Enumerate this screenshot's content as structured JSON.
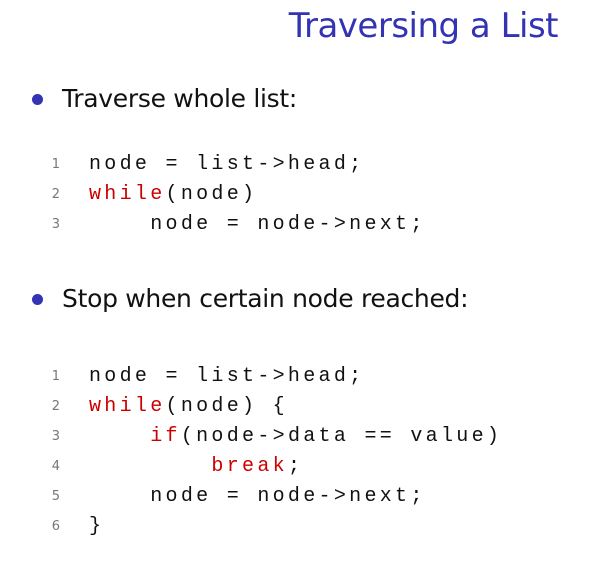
{
  "slide": {
    "title": "Traversing a List",
    "bullets": [
      {
        "text": "Traverse whole list:",
        "code": [
          {
            "n": "1",
            "indent": "",
            "tokens": [
              {
                "t": "node = list->head;"
              }
            ]
          },
          {
            "n": "2",
            "indent": "",
            "tokens": [
              {
                "t": "while",
                "kw": true
              },
              {
                "t": "(node)"
              }
            ]
          },
          {
            "n": "3",
            "indent": "    ",
            "tokens": [
              {
                "t": "node = node->next;"
              }
            ]
          }
        ]
      },
      {
        "text": "Stop when certain node reached:",
        "code": [
          {
            "n": "1",
            "indent": "",
            "tokens": [
              {
                "t": "node = list->head;"
              }
            ]
          },
          {
            "n": "2",
            "indent": "",
            "tokens": [
              {
                "t": "while",
                "kw": true
              },
              {
                "t": "(node) {"
              }
            ]
          },
          {
            "n": "3",
            "indent": "    ",
            "tokens": [
              {
                "t": "if",
                "kw": true
              },
              {
                "t": "(node->data == value)"
              }
            ]
          },
          {
            "n": "4",
            "indent": "        ",
            "tokens": [
              {
                "t": "break",
                "kw": true
              },
              {
                "t": ";"
              }
            ]
          },
          {
            "n": "5",
            "indent": "    ",
            "tokens": [
              {
                "t": "node = node->next;"
              }
            ]
          },
          {
            "n": "6",
            "indent": "",
            "tokens": [
              {
                "t": "}"
              }
            ]
          }
        ]
      }
    ]
  },
  "colors": {
    "title": "#3333b3",
    "bullet": "#3333b3",
    "keyword": "#cc0000",
    "line_number": "#777777"
  }
}
